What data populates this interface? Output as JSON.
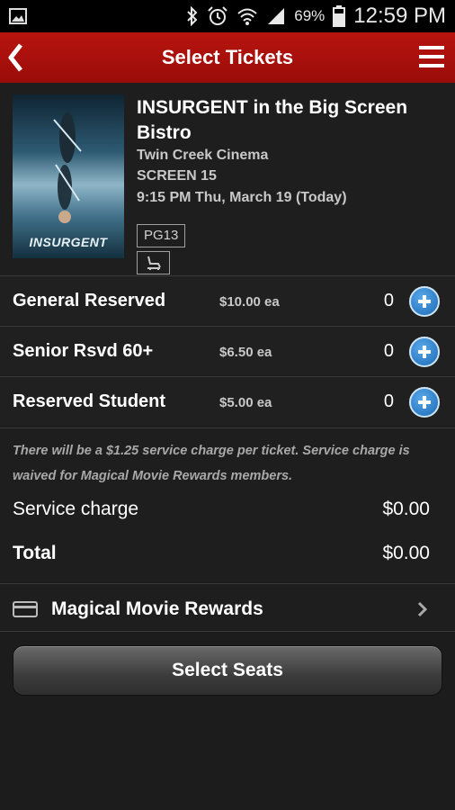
{
  "status_bar": {
    "battery_percent": "69%",
    "time": "12:59 PM",
    "icons": [
      "image-icon",
      "bluetooth-icon",
      "alarm-icon",
      "wifi-icon",
      "signal-icon",
      "battery-icon"
    ]
  },
  "header": {
    "title": "Select Tickets",
    "back_icon": "chevron-left-icon",
    "menu_icon": "hamburger-menu-icon"
  },
  "movie": {
    "poster_title": "INSURGENT",
    "title": "INSURGENT in the Big Screen Bistro",
    "theater": "Twin Creek Cinema",
    "screen": "SCREEN 15",
    "showtime": "9:15 PM Thu, March 19 (Today)",
    "rating": "PG13",
    "amenity_icon": "recliner-seat-icon"
  },
  "tickets": [
    {
      "name": "General Reserved",
      "price": "$10.00 ea",
      "qty": "0"
    },
    {
      "name": "Senior Rsvd 60+",
      "price": "$6.50 ea",
      "qty": "0"
    },
    {
      "name": "Reserved Student",
      "price": "$5.00 ea",
      "qty": "0"
    }
  ],
  "summary": {
    "note": "There will be a $1.25 service charge per ticket. Service charge is waived for Magical Movie Rewards members.",
    "service_charge_label": "Service charge",
    "service_charge_value": "$0.00",
    "total_label": "Total",
    "total_value": "$0.00"
  },
  "rewards": {
    "label": "Magical Movie Rewards",
    "icon": "card-icon"
  },
  "actions": {
    "select_seats": "Select Seats"
  },
  "colors": {
    "header_red": "#a8100b",
    "plus_blue": "#2a7bc6",
    "background": "#1c1c1c"
  }
}
